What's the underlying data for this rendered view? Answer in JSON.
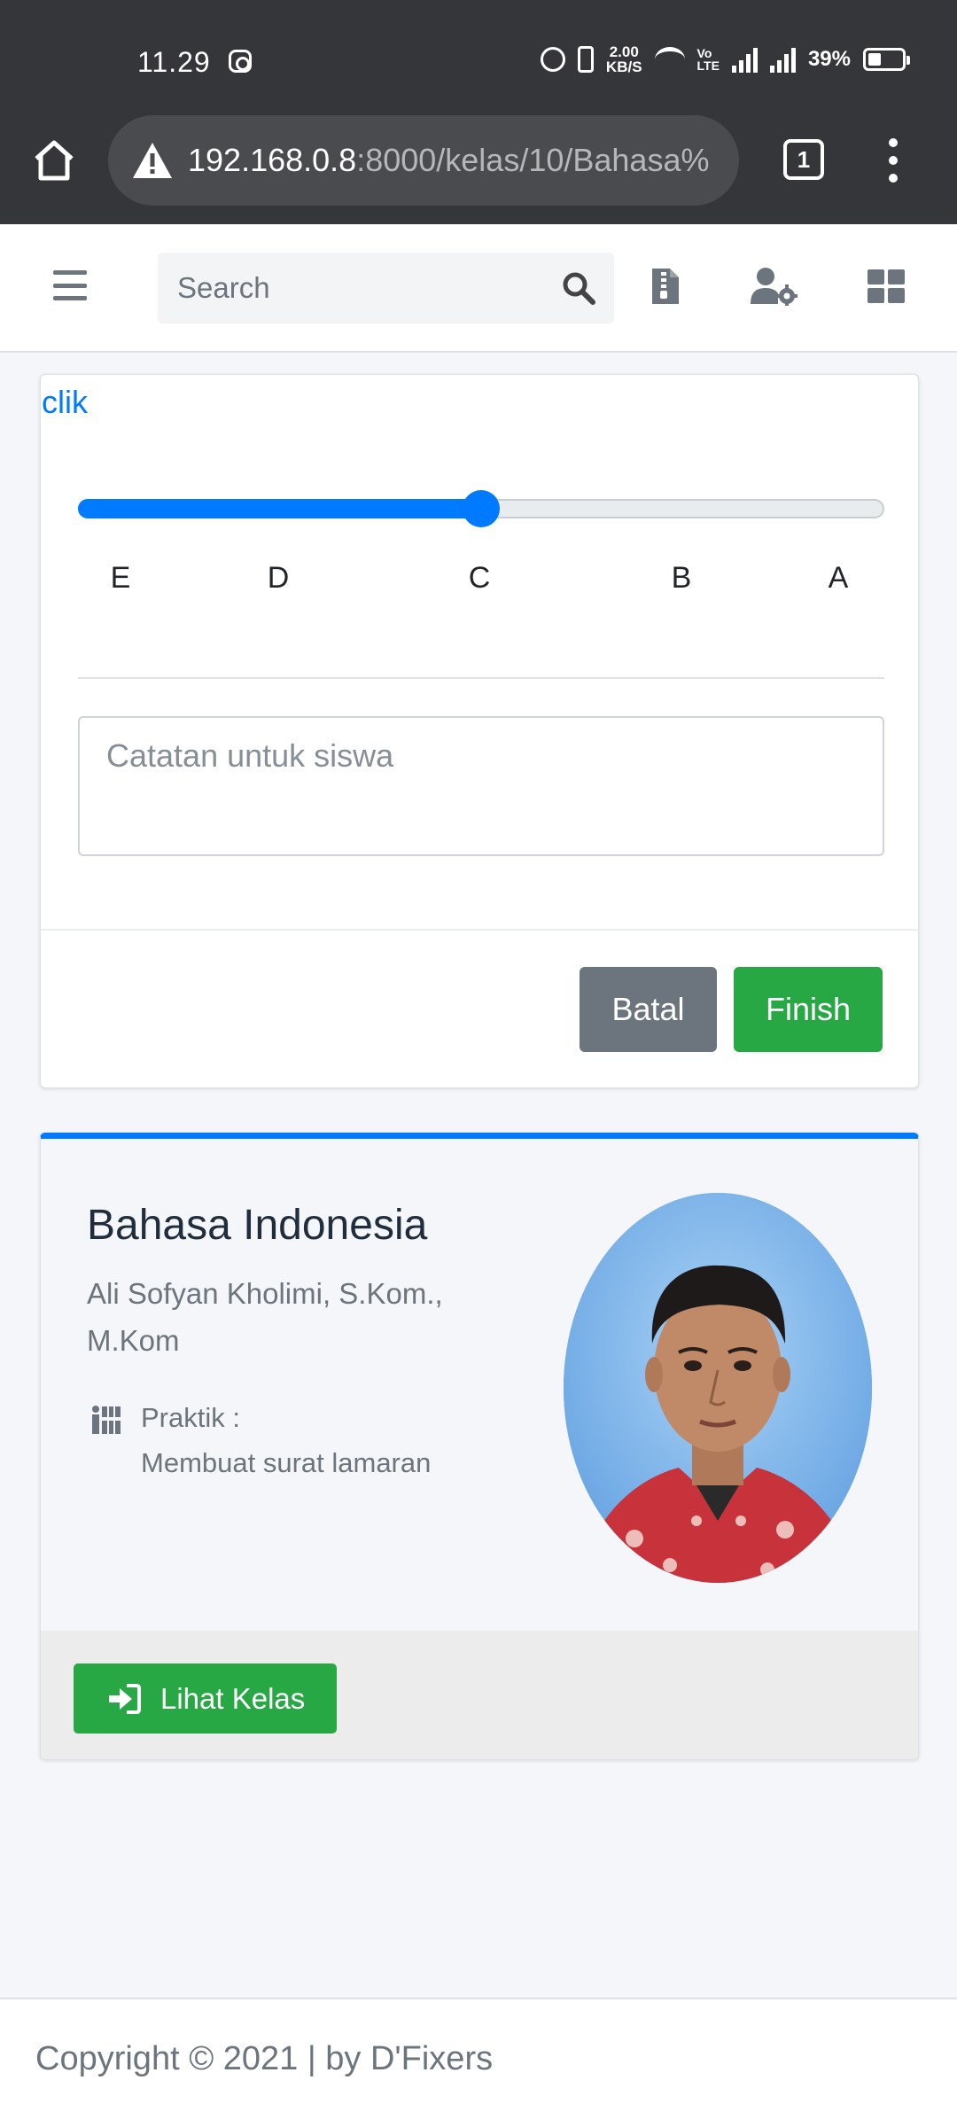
{
  "status_bar": {
    "time": "11.29",
    "net_speed_value": "2.00",
    "net_speed_unit": "KB/S",
    "volte_top": "Vo",
    "volte_bottom": "LTE",
    "battery": "39%"
  },
  "browser": {
    "url_host": "192.168.0.8",
    "url_path": ":8000/kelas/10/Bahasa%",
    "tab_count": "1"
  },
  "navbar": {
    "search_placeholder": "Search"
  },
  "grade_card": {
    "link_label": "clik",
    "slider": {
      "labels": [
        "E",
        "D",
        "C",
        "B",
        "A"
      ],
      "value": 0.5
    },
    "notes_placeholder": "Catatan untuk siswa",
    "cancel_label": "Batal",
    "finish_label": "Finish"
  },
  "class_card": {
    "title": "Bahasa Indonesia",
    "teacher": "Ali Sofyan Kholimi, S.Kom., M.Kom",
    "task_type": "Praktik   :",
    "task_desc": "Membuat surat lamaran",
    "view_label": "Lihat Kelas"
  },
  "footer": {
    "copyright": "Copyright © 2021 | by D'Fixers"
  },
  "colors": {
    "primary": "#007bff",
    "success": "#28a745",
    "secondary": "#6c757d"
  }
}
